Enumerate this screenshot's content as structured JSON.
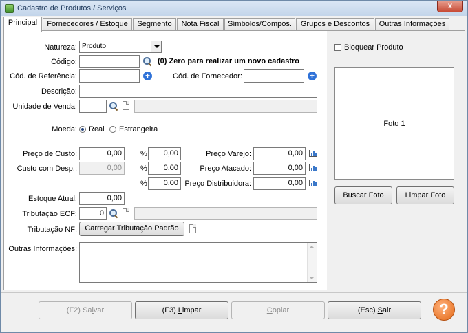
{
  "window": {
    "title": "Cadastro de Produtos / Serviços",
    "close": "x"
  },
  "tabs": [
    {
      "label": "Principal",
      "active": true
    },
    {
      "label": "Fornecedores / Estoque"
    },
    {
      "label": "Segmento"
    },
    {
      "label": "Nota Fiscal"
    },
    {
      "label": "Símbolos/Compos."
    },
    {
      "label": "Grupos e Descontos"
    },
    {
      "label": "Outras Informações"
    }
  ],
  "form": {
    "natureza_label": "Natureza:",
    "natureza_value": "Produto",
    "codigo_label": "Código:",
    "codigo_value": "",
    "codigo_hint": "(0) Zero para realizar um novo cadastro",
    "cod_ref_label": "Cód. de Referência:",
    "cod_ref_value": "",
    "cod_forn_label": "Cód. de Fornecedor:",
    "cod_forn_value": "",
    "descricao_label": "Descrição:",
    "descricao_value": "",
    "unidade_label": "Unidade de Venda:",
    "unidade_value": "",
    "unidade_desc": "",
    "moeda_label": "Moeda:",
    "moeda_real": "Real",
    "moeda_estrangeira": "Estrangeira",
    "preco_custo_label": "Preço de Custo:",
    "preco_custo_value": "0,00",
    "custo_desp_label": "Custo com Desp.:",
    "custo_desp_value": "0,00",
    "pct_symbol": "%",
    "pct1": "0,00",
    "pct2": "0,00",
    "pct3": "0,00",
    "preco_varejo_label": "Preço Varejo:",
    "preco_varejo_value": "0,00",
    "preco_atacado_label": "Preço Atacado:",
    "preco_atacado_value": "0,00",
    "preco_distrib_label": "Preço Distribuidora:",
    "preco_distrib_value": "0,00",
    "estoque_label": "Estoque Atual:",
    "estoque_value": "0,00",
    "trib_ecf_label": "Tributação ECF:",
    "trib_ecf_value": "0",
    "trib_ecf_desc": "",
    "trib_nf_label": "Tributação NF:",
    "trib_nf_button": "Carregar Tributação Padrão",
    "outras_label": "Outras Informações:",
    "outras_value": ""
  },
  "side": {
    "bloquear_label": "Bloquear Produto",
    "foto_label": "Foto 1",
    "buscar_foto": "Buscar Foto",
    "limpar_foto": "Limpar Foto"
  },
  "footer": {
    "salvar_pre": "(F2) Sa",
    "salvar_u": "l",
    "salvar_post": "var",
    "limpar_pre": "(F3) ",
    "limpar_u": "L",
    "limpar_post": "impar",
    "copiar_u": "C",
    "copiar_post": "opiar",
    "sair_pre": "(Esc) ",
    "sair_u": "S",
    "sair_post": "air",
    "help": "?"
  },
  "icons": [
    "app-icon",
    "search-icon",
    "add-icon",
    "document-icon",
    "chart-icon",
    "help-icon"
  ]
}
